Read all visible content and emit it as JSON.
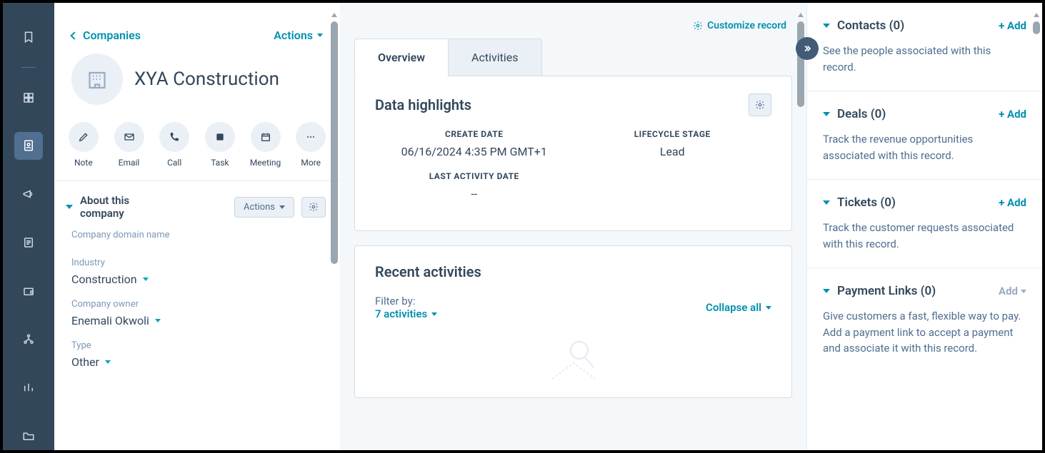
{
  "nav": {
    "back_label": "Companies",
    "actions_label": "Actions"
  },
  "company": {
    "name": "XYA Construction"
  },
  "action_buttons": [
    {
      "id": "note",
      "label": "Note"
    },
    {
      "id": "email",
      "label": "Email"
    },
    {
      "id": "call",
      "label": "Call"
    },
    {
      "id": "task",
      "label": "Task"
    },
    {
      "id": "meeting",
      "label": "Meeting"
    },
    {
      "id": "more",
      "label": "More"
    }
  ],
  "about": {
    "title": "About this company",
    "actions_label": "Actions",
    "props": {
      "domain_label": "Company domain name",
      "domain_value": "",
      "industry_label": "Industry",
      "industry_value": "Construction",
      "owner_label": "Company owner",
      "owner_value": "Enemali Okwoli",
      "type_label": "Type",
      "type_value": "Other"
    }
  },
  "tabs": {
    "overview": "Overview",
    "activities": "Activities"
  },
  "customize_label": "Customize record",
  "highlights": {
    "title": "Data highlights",
    "create_date_k": "CREATE DATE",
    "create_date_v": "06/16/2024 4:35 PM GMT+1",
    "lifecycle_k": "LIFECYCLE STAGE",
    "lifecycle_v": "Lead",
    "last_activity_k": "LAST ACTIVITY DATE",
    "last_activity_v": "--"
  },
  "recent": {
    "title": "Recent activities",
    "filter_label": "Filter by:",
    "filter_value": "7 activities",
    "collapse_label": "Collapse all"
  },
  "assoc": {
    "contacts_title": "Contacts (0)",
    "contacts_add": "+ Add",
    "contacts_desc": "See the people associated with this record.",
    "deals_title": "Deals (0)",
    "deals_add": "+ Add",
    "deals_desc": "Track the revenue opportunities associated with this record.",
    "tickets_title": "Tickets (0)",
    "tickets_add": "+ Add",
    "tickets_desc": "Track the customer requests associated with this record.",
    "payments_title": "Payment Links (0)",
    "payments_add": "Add",
    "payments_desc": "Give customers a fast, flexible way to pay. Add a payment link to accept a payment and associate it with this record."
  }
}
